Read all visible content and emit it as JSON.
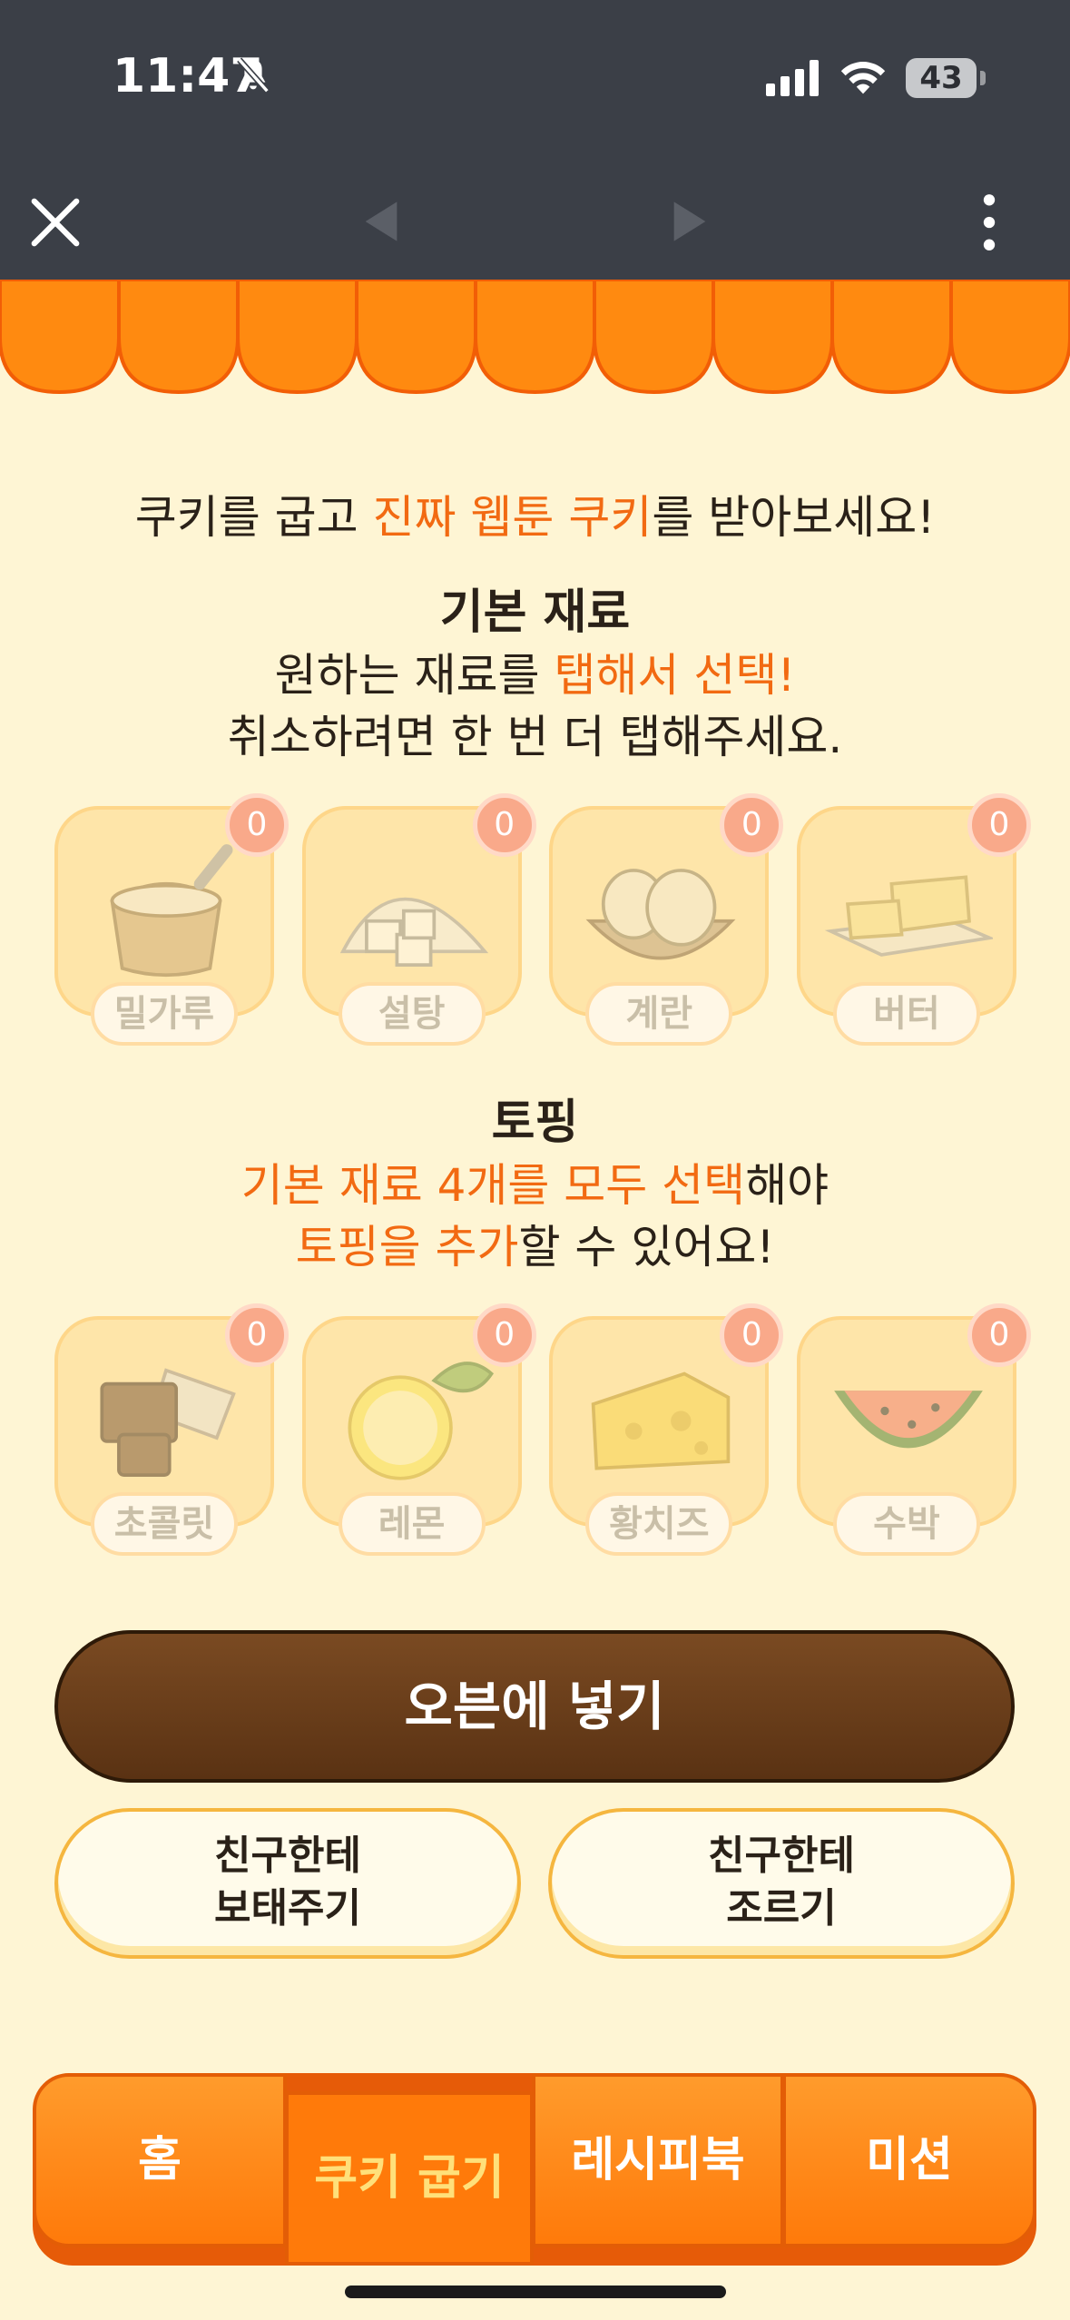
{
  "status_bar": {
    "time": "11:47",
    "battery": "43"
  },
  "tagline": {
    "part1": "쿠키를 굽고 ",
    "highlight": "진짜 웹툰 쿠키",
    "part2": "를 받아보세요!"
  },
  "basic": {
    "title": "기본 재료",
    "desc_line1_a": "원하는 재료를 ",
    "desc_line1_hl": "탭해서 선택!",
    "desc_line2": "취소하려면 한 번 더 탭해주세요.",
    "items": [
      {
        "label": "밀가루",
        "count": "0",
        "icon": "flour-icon"
      },
      {
        "label": "설탕",
        "count": "0",
        "icon": "sugar-icon"
      },
      {
        "label": "계란",
        "count": "0",
        "icon": "egg-icon"
      },
      {
        "label": "버터",
        "count": "0",
        "icon": "butter-icon"
      }
    ]
  },
  "topping": {
    "title": "토핑",
    "desc_line1_hl": "기본 재료 4개를 모두 선택",
    "desc_line1_b": "해야",
    "desc_line2_hl": "토핑을 추가",
    "desc_line2_b": "할 수 있어요!",
    "items": [
      {
        "label": "초콜릿",
        "count": "0",
        "icon": "chocolate-icon"
      },
      {
        "label": "레몬",
        "count": "0",
        "icon": "lemon-icon"
      },
      {
        "label": "황치즈",
        "count": "0",
        "icon": "cheese-icon"
      },
      {
        "label": "수박",
        "count": "0",
        "icon": "watermelon-icon"
      }
    ]
  },
  "buttons": {
    "oven": "오븐에 넣기",
    "gift_line1": "친구한테",
    "gift_line2": "보태주기",
    "ask_line1": "친구한테",
    "ask_line2": "조르기"
  },
  "tabs": [
    {
      "label": "홈"
    },
    {
      "label": "쿠키 굽기",
      "active": true
    },
    {
      "label": "레시피북"
    },
    {
      "label": "미션"
    }
  ],
  "colors": {
    "accent": "#f26a12",
    "background": "#fef5d4",
    "oven_button": "#5a3213",
    "tab_bar": "#ff7a0a"
  }
}
